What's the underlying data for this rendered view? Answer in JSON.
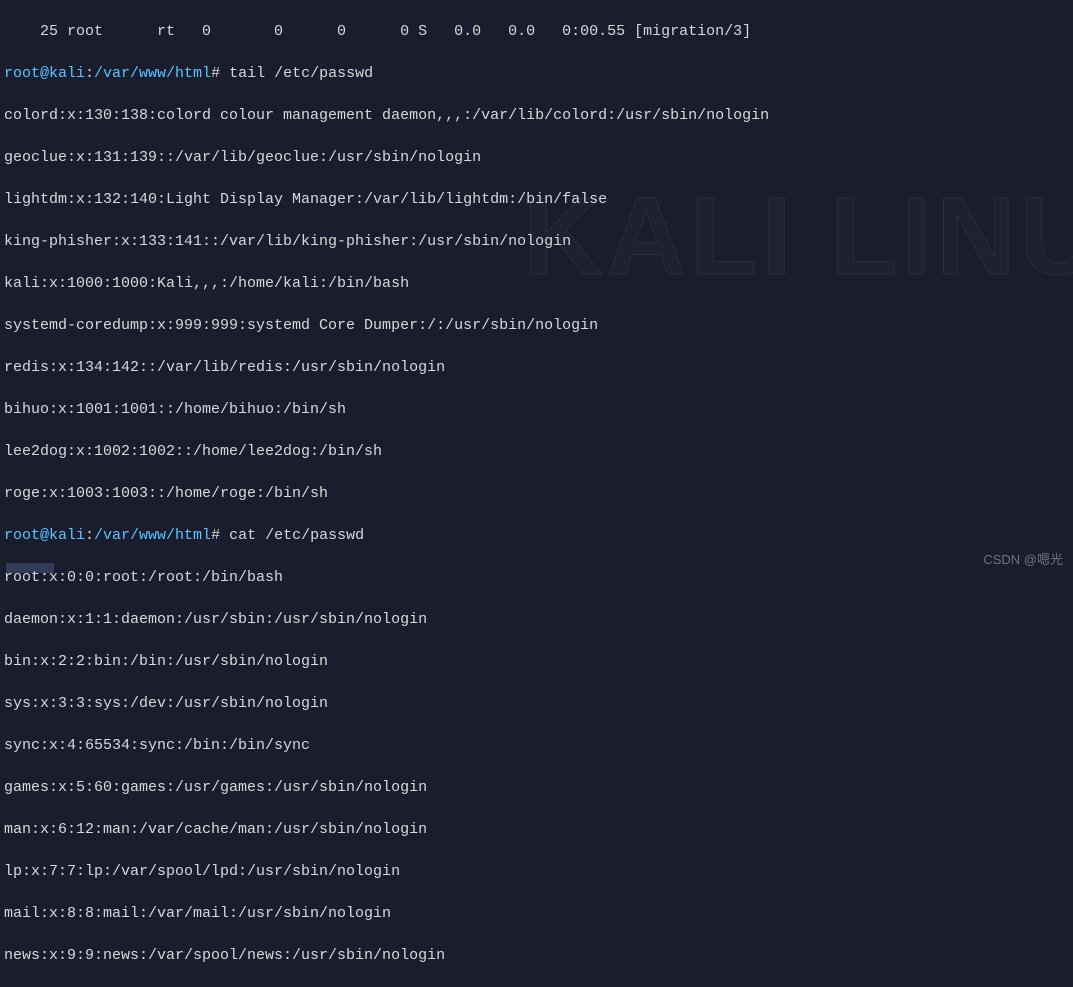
{
  "watermark_bg": "KALI LINU",
  "watermark_corner": "CSDN @嗯光",
  "process_rows": [
    "    25 root      rt   0       0      0      0 S   0.0   0.0   0:00.55 [migration/3]"
  ],
  "prompts": [
    {
      "userhost": "root@kali",
      "path": "/var/www/html",
      "command": "tail /etc/passwd"
    },
    {
      "userhost": "root@kali",
      "path": "/var/www/html",
      "command": "cat /etc/passwd"
    }
  ],
  "tail_output": [
    "colord:x:130:138:colord colour management daemon,,,:/var/lib/colord:/usr/sbin/nologin",
    "geoclue:x:131:139::/var/lib/geoclue:/usr/sbin/nologin",
    "lightdm:x:132:140:Light Display Manager:/var/lib/lightdm:/bin/false",
    "king-phisher:x:133:141::/var/lib/king-phisher:/usr/sbin/nologin",
    "kali:x:1000:1000:Kali,,,:/home/kali:/bin/bash",
    "systemd-coredump:x:999:999:systemd Core Dumper:/:/usr/sbin/nologin",
    "redis:x:134:142::/var/lib/redis:/usr/sbin/nologin",
    "bihuo:x:1001:1001::/home/bihuo:/bin/sh",
    "lee2dog:x:1002:1002::/home/lee2dog:/bin/sh",
    "roge:x:1003:1003::/home/roge:/bin/sh"
  ],
  "cat_output": [
    "root:x:0:0:root:/root:/bin/bash",
    "daemon:x:1:1:daemon:/usr/sbin:/usr/sbin/nologin",
    "bin:x:2:2:bin:/bin:/usr/sbin/nologin",
    "sys:x:3:3:sys:/dev:/usr/sbin/nologin",
    "sync:x:4:65534:sync:/bin:/bin/sync",
    "games:x:5:60:games:/usr/games:/usr/sbin/nologin",
    "man:x:6:12:man:/var/cache/man:/usr/sbin/nologin",
    "lp:x:7:7:lp:/var/spool/lpd:/usr/sbin/nologin",
    "mail:x:8:8:mail:/var/mail:/usr/sbin/nologin",
    "news:x:9:9:news:/var/spool/news:/usr/sbin/nologin"
  ]
}
